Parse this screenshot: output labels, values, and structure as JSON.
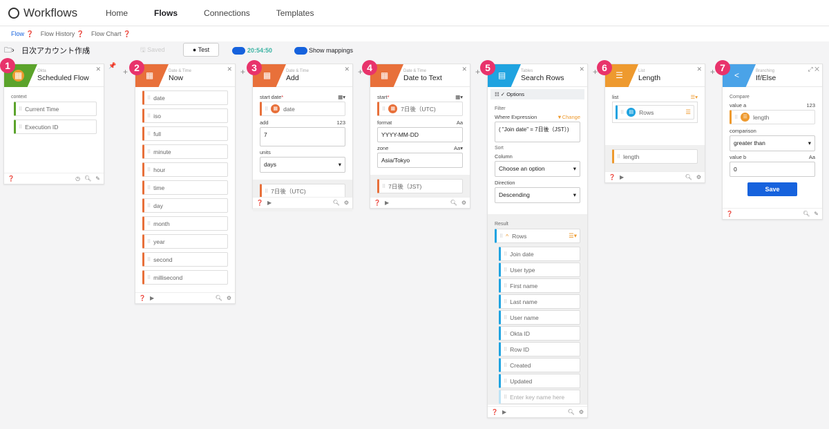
{
  "app": {
    "title": "Workflows",
    "nav": [
      "Home",
      "Flows",
      "Connections",
      "Templates"
    ],
    "active_nav": "Flows"
  },
  "subnav": [
    "Flow",
    "Flow History",
    "Flow Chart"
  ],
  "toolbar": {
    "flow_name": "日次アカウント作成",
    "saved": "Saved",
    "test": "Test",
    "time": "20:54:50",
    "show_mappings": "Show mappings"
  },
  "colors": {
    "accent": "#1662dd",
    "badge": "#e8336b",
    "datetime": "#e8703a",
    "tables": "#1fa3e0",
    "list": "#ee9a2f",
    "branching": "#4aa3e8",
    "okta": "#5ba32b"
  },
  "cards": [
    {
      "num": "1",
      "category": "Okta",
      "title": "Scheduled Flow",
      "section": "context",
      "fields": [
        "Current Time",
        "Execution ID"
      ]
    },
    {
      "num": "2",
      "category": "Date & Time",
      "title": "Now",
      "fields": [
        "date",
        "iso",
        "full",
        "minute",
        "hour",
        "time",
        "day",
        "month",
        "year",
        "second",
        "millisecond"
      ]
    },
    {
      "num": "3",
      "category": "Date & Time",
      "title": "Add",
      "start_label": "start date",
      "start_value": "date",
      "add_label": "add",
      "add_type": "123",
      "add_value": "7",
      "units_label": "units",
      "units_value": "days",
      "output": "7日後（UTC)"
    },
    {
      "num": "4",
      "category": "Date & Time",
      "title": "Date to Text",
      "start_label": "start",
      "start_value": "7日後（UTC)",
      "format_label": "format",
      "format_type": "Aa",
      "format_value": "YYYY-MM-DD",
      "zone_label": "zone",
      "zone_value": "Asia/Tokyo",
      "output": "7日後（JST)"
    },
    {
      "num": "5",
      "category": "Tables",
      "title": "Search Rows",
      "options": "Options",
      "filter": "Filter",
      "where_label": "Where Expression",
      "change": "Change",
      "where_value": "( \"Join date\" = 7日後（JST）)",
      "sort": "Sort",
      "column_label": "Column",
      "column_value": "Choose an option",
      "direction_label": "Direction",
      "direction_value": "Descending",
      "result": "Result",
      "rows": "Rows",
      "row_fields": [
        "Join date",
        "User type",
        "First name",
        "Last name",
        "User name",
        "Okta ID",
        "Row ID",
        "Created",
        "Updated"
      ],
      "key_placeholder": "Enter key name here"
    },
    {
      "num": "6",
      "category": "List",
      "title": "Length",
      "list_label": "list",
      "list_value": "Rows",
      "output": "length"
    },
    {
      "num": "7",
      "category": "Branching",
      "title": "If/Else",
      "section": "Compare",
      "value_a_label": "value a",
      "value_a_type": "123",
      "value_a": "length",
      "comparison_label": "comparison",
      "comparison_value": "greater than",
      "value_b_label": "value b",
      "value_b_type": "Aa",
      "value_b": "0",
      "save": "Save"
    }
  ]
}
